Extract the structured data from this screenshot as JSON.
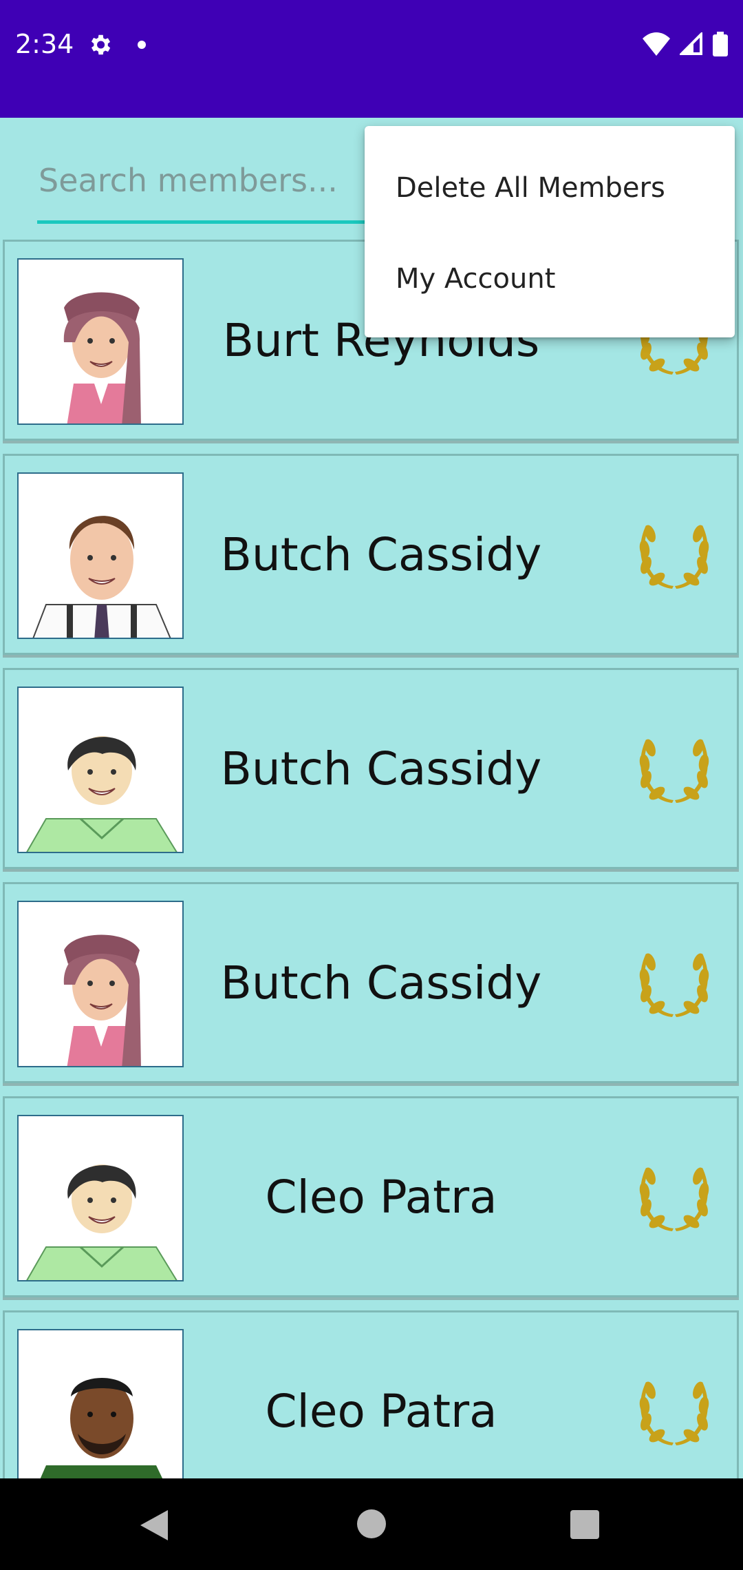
{
  "status_bar": {
    "time": "2:34",
    "icons": [
      "settings-icon",
      "notification-dot-icon",
      "wifi-icon",
      "cellular-signal-icon",
      "battery-icon"
    ],
    "background": "#3f00b5"
  },
  "search": {
    "placeholder": "Search members..."
  },
  "members": [
    {
      "name": "Burt Reynolds",
      "avatar": "woman-headscarf-pink-shirt",
      "badge": "laurel-icon"
    },
    {
      "name": "Butch Cassidy",
      "avatar": "man-brown-hair-tie",
      "badge": "laurel-icon"
    },
    {
      "name": "Butch Cassidy",
      "avatar": "boy-black-hair-green-shirt",
      "badge": "laurel-icon"
    },
    {
      "name": "Butch Cassidy",
      "avatar": "woman-headscarf-pink-shirt",
      "badge": "laurel-icon"
    },
    {
      "name": "Cleo Patra",
      "avatar": "boy-black-hair-green-shirt",
      "badge": "laurel-icon"
    },
    {
      "name": "Cleo Patra",
      "avatar": "man-beard-green-shirt",
      "badge": "laurel-icon"
    }
  ],
  "overflow_menu": {
    "items": [
      "Delete All Members",
      "My Account"
    ]
  },
  "nav_bar": {
    "buttons": [
      "back-icon",
      "home-icon",
      "recents-icon"
    ]
  },
  "colors": {
    "accent": "#1bc8be",
    "card_background": "#a4e6e4",
    "laurel": "#c8a21a"
  }
}
